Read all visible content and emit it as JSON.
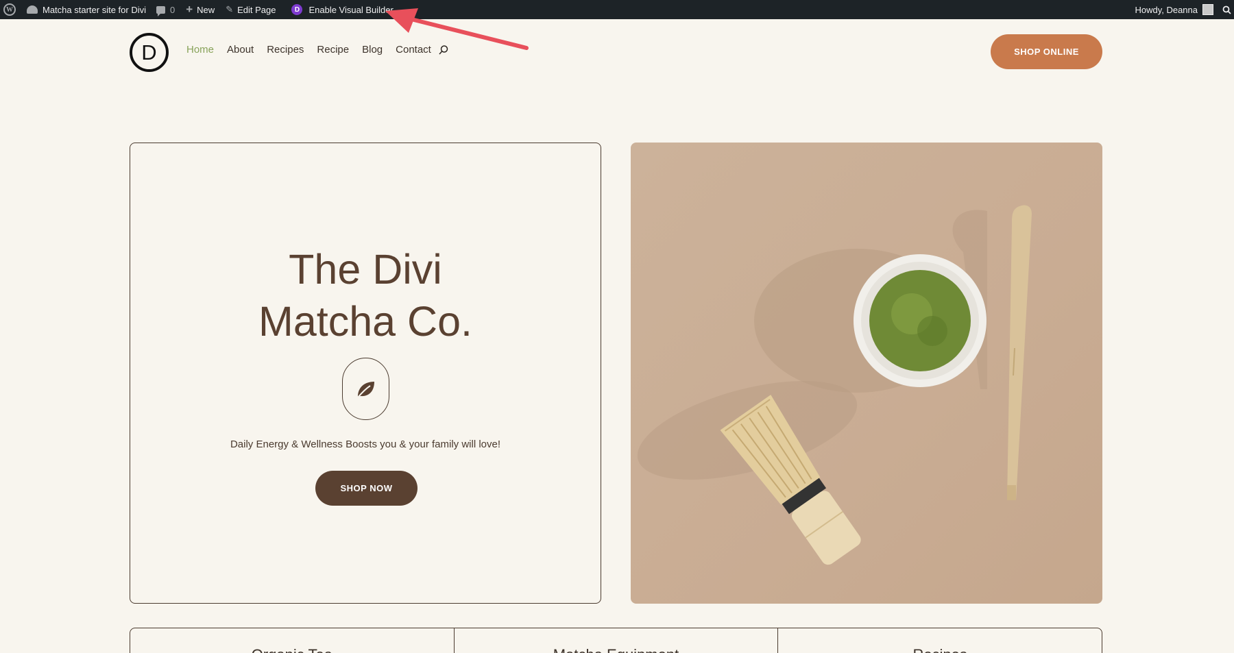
{
  "admin_bar": {
    "site_name": "Matcha starter site for Divi",
    "comment_count": "0",
    "new_label": "New",
    "edit_page_label": "Edit Page",
    "visual_builder_label": "Enable Visual Builder",
    "howdy_label": "Howdy, Deanna"
  },
  "header": {
    "logo_letter": "D",
    "nav": [
      {
        "label": "Home",
        "active": true
      },
      {
        "label": "About"
      },
      {
        "label": "Recipes"
      },
      {
        "label": "Recipe"
      },
      {
        "label": "Blog"
      },
      {
        "label": "Contact"
      }
    ],
    "shop_online_label": "SHOP ONLINE"
  },
  "hero": {
    "title_line1": "The Divi",
    "title_line2": "Matcha Co.",
    "tagline": "Daily Energy & Wellness Boosts you & your family will love!",
    "cta_label": "SHOP NOW",
    "image": "matcha-bowl-whisk-spoon"
  },
  "categories": [
    "Organic Tea",
    "Matcha Equipment",
    "Recipes"
  ],
  "colors": {
    "background": "#f8f5ee",
    "admin_bar": "#1d2327",
    "accent_orange": "#c97a4c",
    "dark_brown": "#5a4131",
    "active_nav": "#88a35a",
    "annotation_arrow": "#e8505b"
  }
}
